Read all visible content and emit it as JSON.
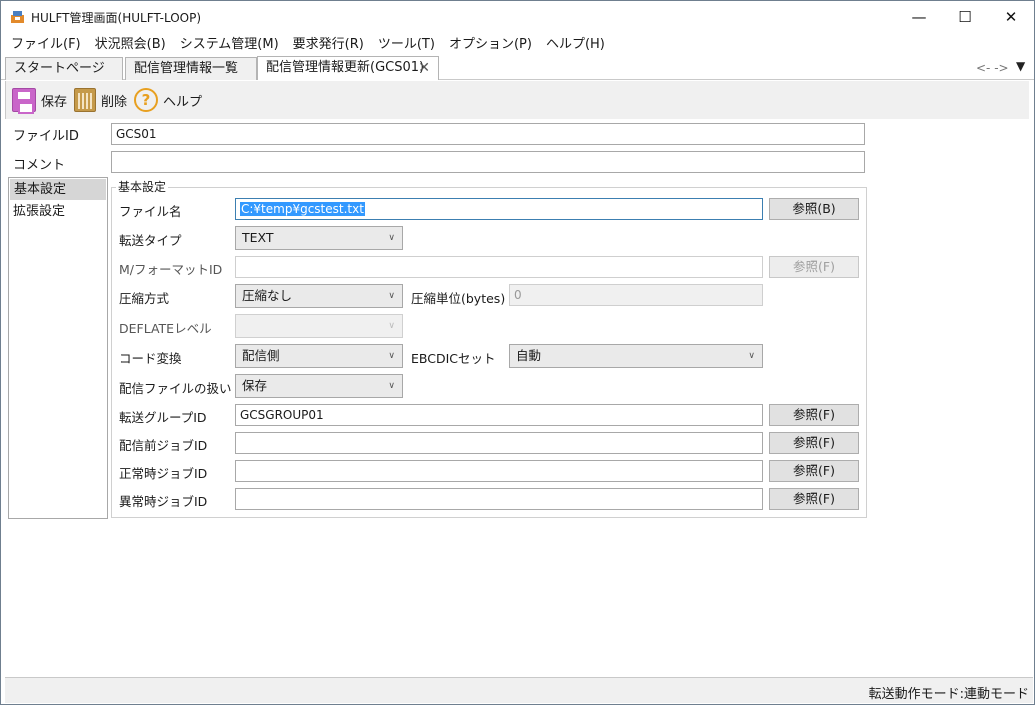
{
  "window": {
    "title": "HULFT管理画面(HULFT-LOOP)"
  },
  "menu": [
    "ファイル(F)",
    "状況照会(B)",
    "システム管理(M)",
    "要求発行(R)",
    "ツール(T)",
    "オプション(P)",
    "ヘルプ(H)"
  ],
  "tabs": [
    "スタートページ",
    "配信管理情報一覧",
    "配信管理情報更新(GCS01)"
  ],
  "tab_nav": "<- ->",
  "toolbar": {
    "save": "保存",
    "delete": "削除",
    "help": "ヘルプ"
  },
  "header": {
    "file_id_label": "ファイルID",
    "file_id_value": "GCS01",
    "comment_label": "コメント",
    "comment_value": ""
  },
  "sidenav": [
    "基本設定",
    "拡張設定"
  ],
  "group_title": "基本設定",
  "form": {
    "file_name_label": "ファイル名",
    "file_name_value": "C:¥temp¥gcstest.txt",
    "file_name_button": "参照(B)",
    "transfer_type_label": "転送タイプ",
    "transfer_type_value": "TEXT",
    "format_id_label": "M/フォーマットID",
    "format_id_value": "",
    "format_id_button": "参照(F)",
    "compression_label": "圧縮方式",
    "compression_value": "圧縮なし",
    "compression_unit_label": "圧縮単位(bytes)",
    "compression_unit_value": "0",
    "deflate_label": "DEFLATEレベル",
    "deflate_value": "",
    "code_conv_label": "コード変換",
    "code_conv_value": "配信側",
    "ebcdic_label": "EBCDICセット",
    "ebcdic_value": "自動",
    "file_handling_label": "配信ファイルの扱い",
    "file_handling_value": "保存",
    "group_id_label": "転送グループID",
    "group_id_value": "GCSGROUP01",
    "group_id_button": "参照(F)",
    "pre_job_label": "配信前ジョブID",
    "pre_job_value": "",
    "pre_job_button": "参照(F)",
    "normal_job_label": "正常時ジョブID",
    "normal_job_value": "",
    "normal_job_button": "参照(F)",
    "error_job_label": "異常時ジョブID",
    "error_job_value": "",
    "error_job_button": "参照(F)"
  },
  "status": "転送動作モード:連動モード"
}
